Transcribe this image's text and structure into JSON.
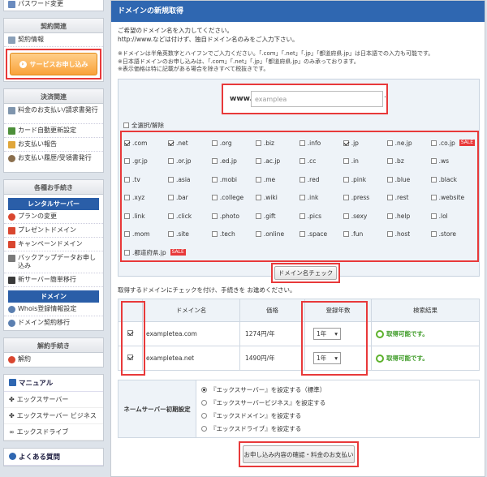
{
  "sidebar": {
    "top_item": "パスワード変更",
    "contract": {
      "header": "契約関連",
      "item": "契約情報",
      "apply_button": "サービスお申し込み"
    },
    "billing": {
      "header": "決済関連",
      "items": [
        "料金のお支払い/請求書発行",
        "カード自動更新設定",
        "お支払い報告",
        "お支払い履歴/受領書発行"
      ]
    },
    "procedures": {
      "header": "各種お手続き",
      "rental_header": "レンタルサーバー",
      "rental_items": [
        "プランの変更",
        "プレゼントドメイン",
        "キャンペーンドメイン",
        "バックアップデータお申し込み",
        "新サーバー簡単移行"
      ],
      "domain_header": "ドメイン",
      "domain_items": [
        "Whois登録情報設定",
        "ドメイン契約移行"
      ]
    },
    "cancel": {
      "header": "解約手続き",
      "item": "解約"
    },
    "manual": {
      "header": "マニュアル",
      "items": [
        "エックスサーバー",
        "エックスサーバー ビジネス",
        "エックスドライブ"
      ]
    },
    "faq": "よくある質問"
  },
  "main": {
    "title": "ドメインの新規取得",
    "intro": [
      "ご希望のドメイン名を入力してください。",
      "http://www.などは付けず、独自ドメイン名のみをご入力下さい。"
    ],
    "notes": [
      "※ドメインは半角英数字とハイフンでご入力ください。「.com」「.net」「.jp」「都道府県.jp」は日本語での入力も可能です。",
      "※日本語ドメインのお申し込みは、「.com」「.net」「.jp」「都道府県.jp」のみ承っております。",
      "※表示価格は特に記載がある場合を除きすべて税抜きです。"
    ],
    "www_label": "www.",
    "domain_input_value": "examplea",
    "www_dot": ".",
    "select_all": "全選択/解除",
    "tlds": [
      {
        "name": ".com",
        "checked": true
      },
      {
        "name": ".net",
        "checked": true
      },
      {
        "name": ".org",
        "checked": false
      },
      {
        "name": ".biz",
        "checked": false
      },
      {
        "name": ".info",
        "checked": false
      },
      {
        "name": ".jp",
        "checked": true
      },
      {
        "name": ".ne.jp",
        "checked": false
      },
      {
        "name": ".co.jp",
        "checked": false,
        "sale": "SALE"
      },
      {
        "name": ".gr.jp",
        "checked": false
      },
      {
        "name": ".or.jp",
        "checked": false
      },
      {
        "name": ".ed.jp",
        "checked": false
      },
      {
        "name": ".ac.jp",
        "checked": false
      },
      {
        "name": ".cc",
        "checked": false
      },
      {
        "name": ".in",
        "checked": false
      },
      {
        "name": ".bz",
        "checked": false
      },
      {
        "name": ".ws",
        "checked": false
      },
      {
        "name": ".tv",
        "checked": false
      },
      {
        "name": ".asia",
        "checked": false
      },
      {
        "name": ".mobi",
        "checked": false
      },
      {
        "name": ".me",
        "checked": false
      },
      {
        "name": ".red",
        "checked": false
      },
      {
        "name": ".pink",
        "checked": false
      },
      {
        "name": ".blue",
        "checked": false
      },
      {
        "name": ".black",
        "checked": false
      },
      {
        "name": ".xyz",
        "checked": false
      },
      {
        "name": ".bar",
        "checked": false
      },
      {
        "name": ".college",
        "checked": false
      },
      {
        "name": ".wiki",
        "checked": false
      },
      {
        "name": ".ink",
        "checked": false
      },
      {
        "name": ".press",
        "checked": false
      },
      {
        "name": ".rest",
        "checked": false
      },
      {
        "name": ".website",
        "checked": false
      },
      {
        "name": ".link",
        "checked": false
      },
      {
        "name": ".click",
        "checked": false
      },
      {
        "name": ".photo",
        "checked": false
      },
      {
        "name": ".gift",
        "checked": false
      },
      {
        "name": ".pics",
        "checked": false
      },
      {
        "name": ".sexy",
        "checked": false
      },
      {
        "name": ".help",
        "checked": false
      },
      {
        "name": ".lol",
        "checked": false
      },
      {
        "name": ".mom",
        "checked": false
      },
      {
        "name": ".site",
        "checked": false
      },
      {
        "name": ".tech",
        "checked": false
      },
      {
        "name": ".online",
        "checked": false
      },
      {
        "name": ".space",
        "checked": false
      },
      {
        "name": ".fun",
        "checked": false
      },
      {
        "name": ".host",
        "checked": false
      },
      {
        "name": ".store",
        "checked": false
      },
      {
        "name": ".都道府県.jp",
        "checked": false,
        "sale": "SALE"
      }
    ],
    "check_button": "ドメイン名チェック",
    "result_note": "取得するドメインにチェックを付け、手続きを お進めください。",
    "table_headers": {
      "domain": "ドメイン名",
      "price": "価格",
      "period": "登録年数",
      "result": "検索結果"
    },
    "results": [
      {
        "domain": "exampletea.com",
        "price": "1274円/年",
        "period": "1年",
        "status": "取得可能です。"
      },
      {
        "domain": "exampletea.net",
        "price": "1490円/年",
        "period": "1年",
        "status": "取得可能です。"
      }
    ],
    "nameserver": {
      "label": "ネームサーバー初期設定",
      "options": [
        {
          "text": "『エックスサーバー』を設定する（標準）",
          "selected": true
        },
        {
          "text": "『エックスサーバービジネス』を設定する",
          "selected": false
        },
        {
          "text": "『エックスドメイン』を設定する",
          "selected": false
        },
        {
          "text": "『エックスドライブ』を設定する",
          "selected": false
        }
      ]
    },
    "submit_button": "お申し込み内容の確認・料金のお支払い"
  },
  "colors": {
    "primary": "#2f67b1",
    "highlight": "#e8393a",
    "apply": "#f9a23a",
    "available": "#3c9a25"
  }
}
